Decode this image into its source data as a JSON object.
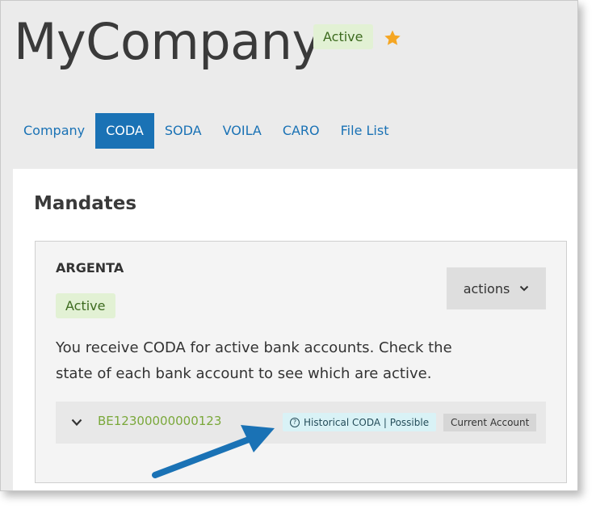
{
  "header": {
    "title": "MyCompany",
    "status": "Active",
    "favorite_icon": "star-icon"
  },
  "tabs": [
    {
      "label": "Company",
      "active": false
    },
    {
      "label": "CODA",
      "active": true
    },
    {
      "label": "SODA",
      "active": false
    },
    {
      "label": "VOILA",
      "active": false
    },
    {
      "label": "CARO",
      "active": false
    },
    {
      "label": "File List",
      "active": false
    }
  ],
  "panel": {
    "title": "Mandates",
    "mandate": {
      "bank": "ARGENTA",
      "status": "Active",
      "actions_label": "actions",
      "description": "You receive CODA for active bank accounts. Check the state of each bank account to see which are active.",
      "account": {
        "iban": "BE12300000000123",
        "history_badge": "Historical CODA | Possible",
        "type_badge": "Current Account"
      }
    }
  },
  "colors": {
    "accent": "#1a72b5",
    "active_badge_bg": "#e2f1d4",
    "star": "#f5a623",
    "iban": "#7aa83a",
    "arrow": "#1a72b5"
  }
}
